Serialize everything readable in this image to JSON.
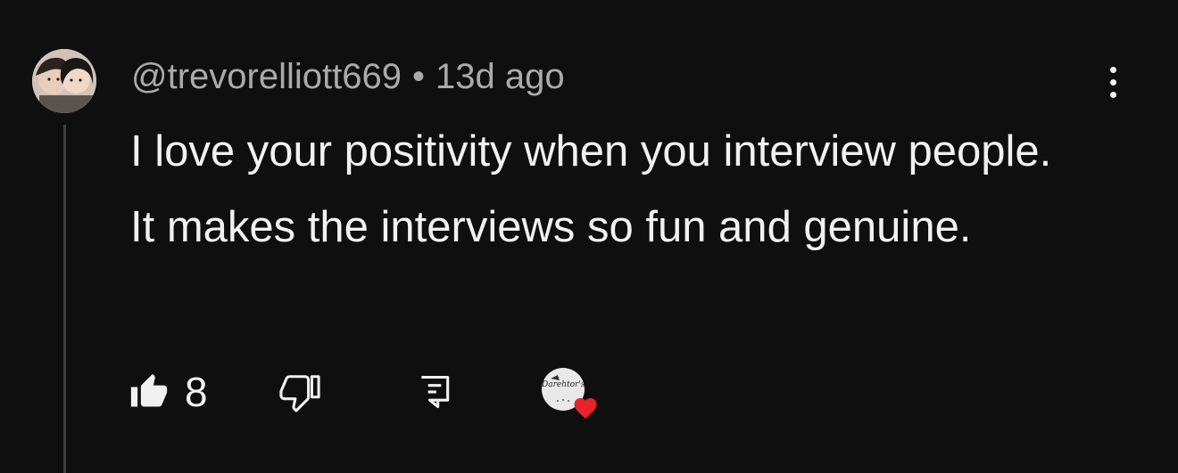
{
  "comment": {
    "author": "@trevorelliott669",
    "separator": "•",
    "timestamp": "13d ago",
    "text": "I love your positivity when you interview people. It makes the interviews so fun and genuine."
  },
  "actions": {
    "like_count": "8",
    "creator_logo_text": "Darehtor's"
  },
  "colors": {
    "background": "#0f0f0f",
    "primary_text": "#f1f1f1",
    "secondary_text": "#aaaaaa",
    "thread_line": "#3f3f3f",
    "heart": "#e8232c"
  },
  "icons": {
    "like": "thumbs-up-filled-icon",
    "dislike": "thumbs-down-outline-icon",
    "reply": "comment-reply-icon",
    "more": "vertical-ellipsis-icon",
    "creator_heart": "heart-icon"
  }
}
